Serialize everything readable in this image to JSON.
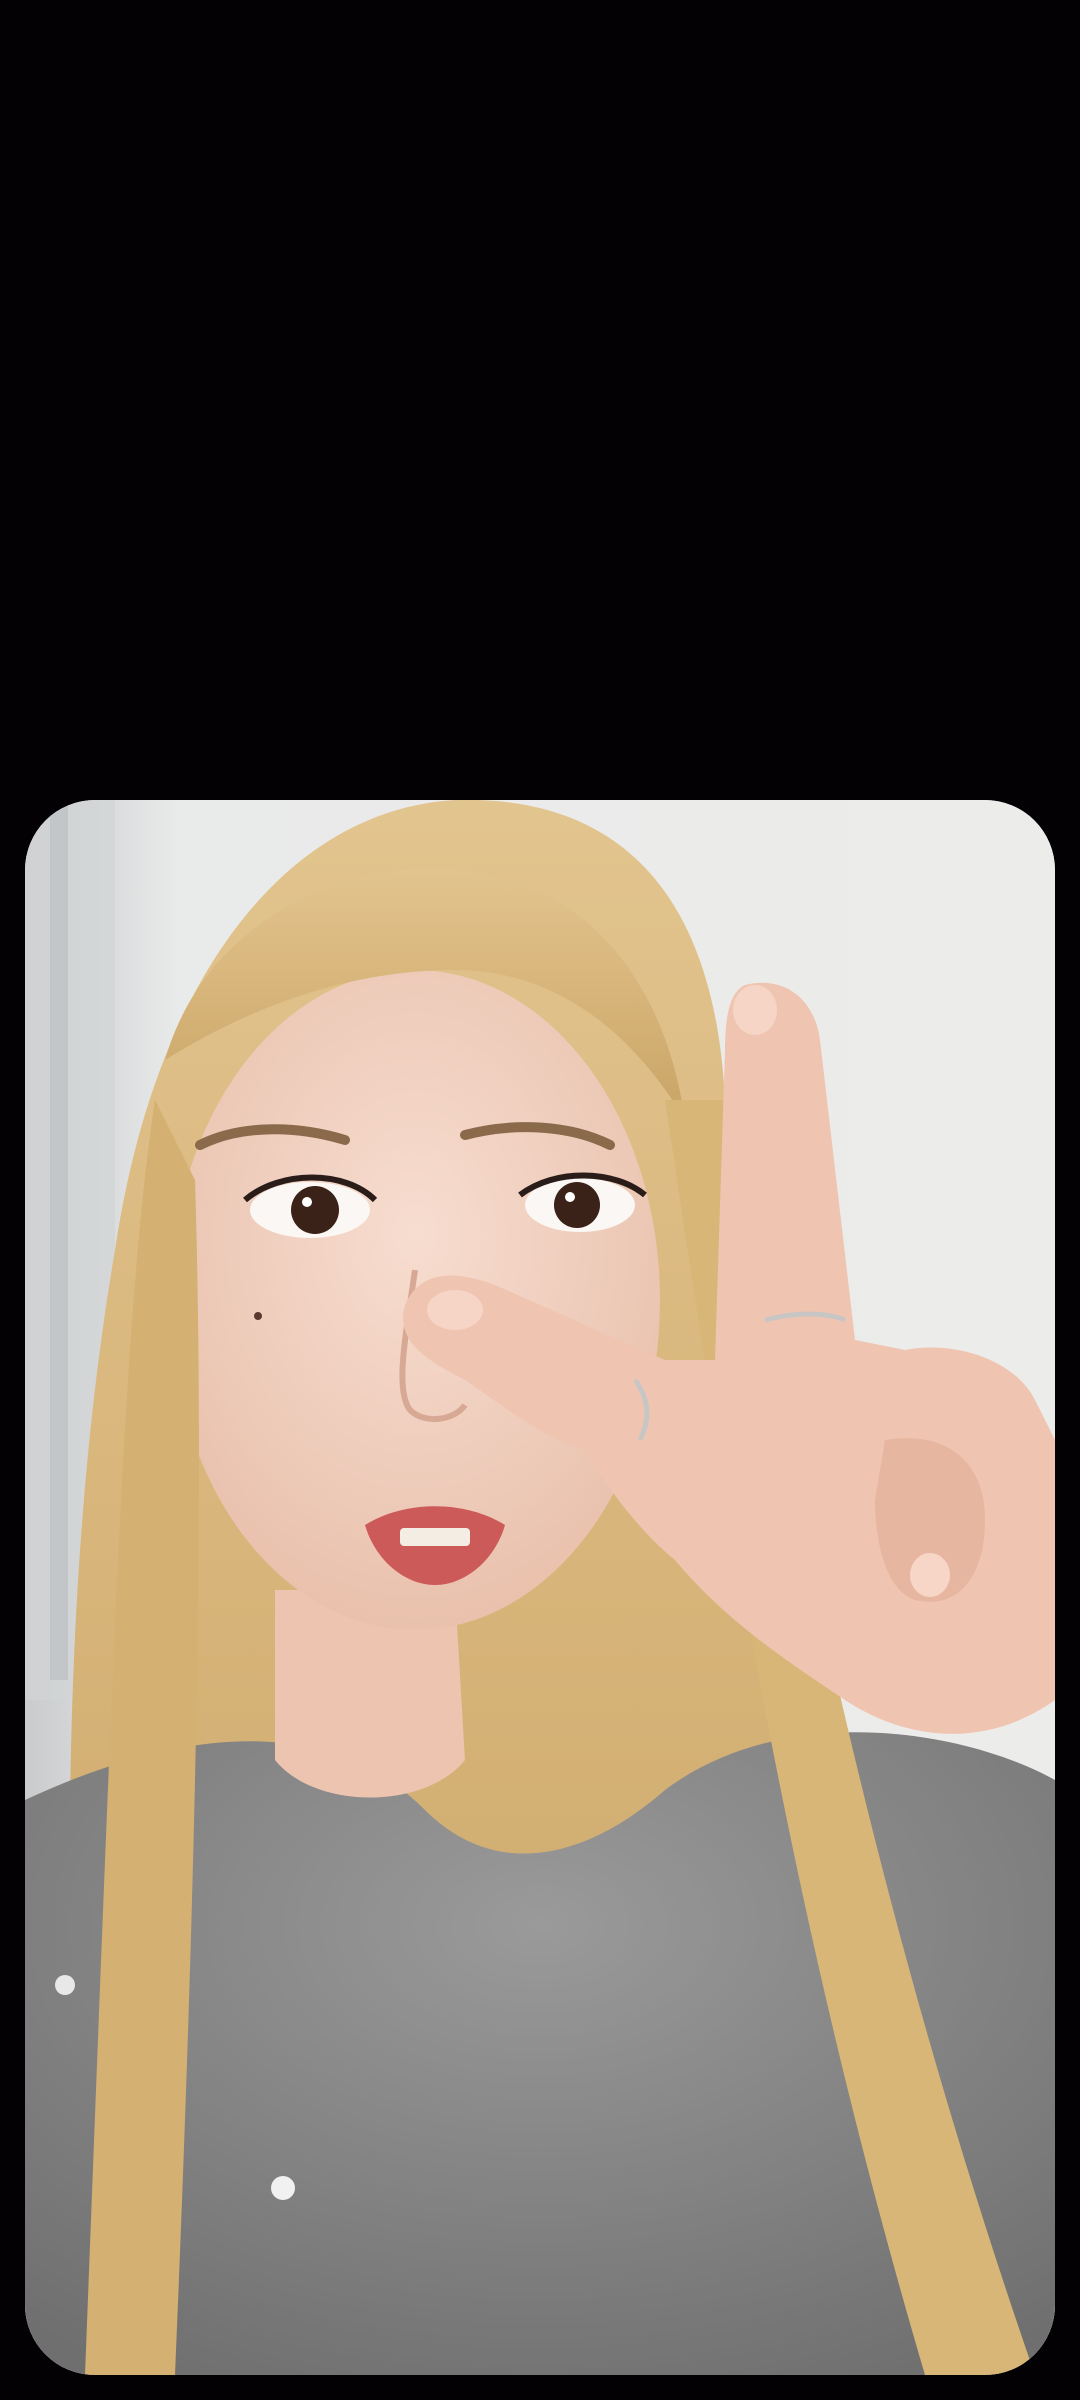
{
  "screen": {
    "background_color": "#030104"
  },
  "photo": {
    "subject": "selfie-peace-sign",
    "background_color": "#e6e6e4",
    "hair_color": "#d9b879",
    "sweater_color": "#8a8a8a",
    "skin_color": "#f1cfc0"
  }
}
